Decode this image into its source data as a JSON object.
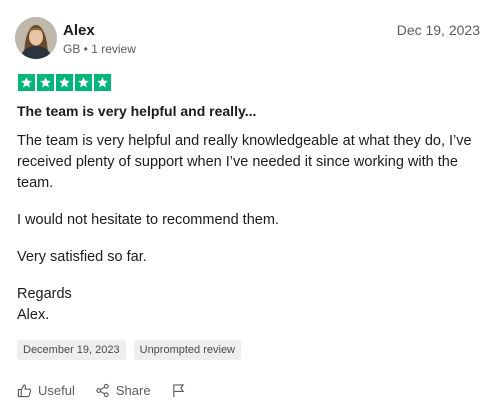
{
  "review": {
    "author": "Alex",
    "meta": "GB • 1 review",
    "date": "Dec 19, 2023",
    "rating": 5,
    "title": "The team is very helpful and really...",
    "paragraphs": [
      "The team is very helpful and really knowledgeable at what they do, I’ve received plenty of support when I’ve needed it since working with the team.",
      "I would not hesitate to recommend them.",
      "Very satisfied so far.",
      "Regards\nAlex."
    ],
    "badges": [
      "December 19, 2023",
      "Unprompted review"
    ],
    "actions": {
      "useful": "Useful",
      "share": "Share"
    }
  },
  "colors": {
    "star_green": "#00b67a"
  },
  "icons": [
    "thumbs-up-icon",
    "share-icon",
    "flag-icon",
    "star-icon"
  ]
}
